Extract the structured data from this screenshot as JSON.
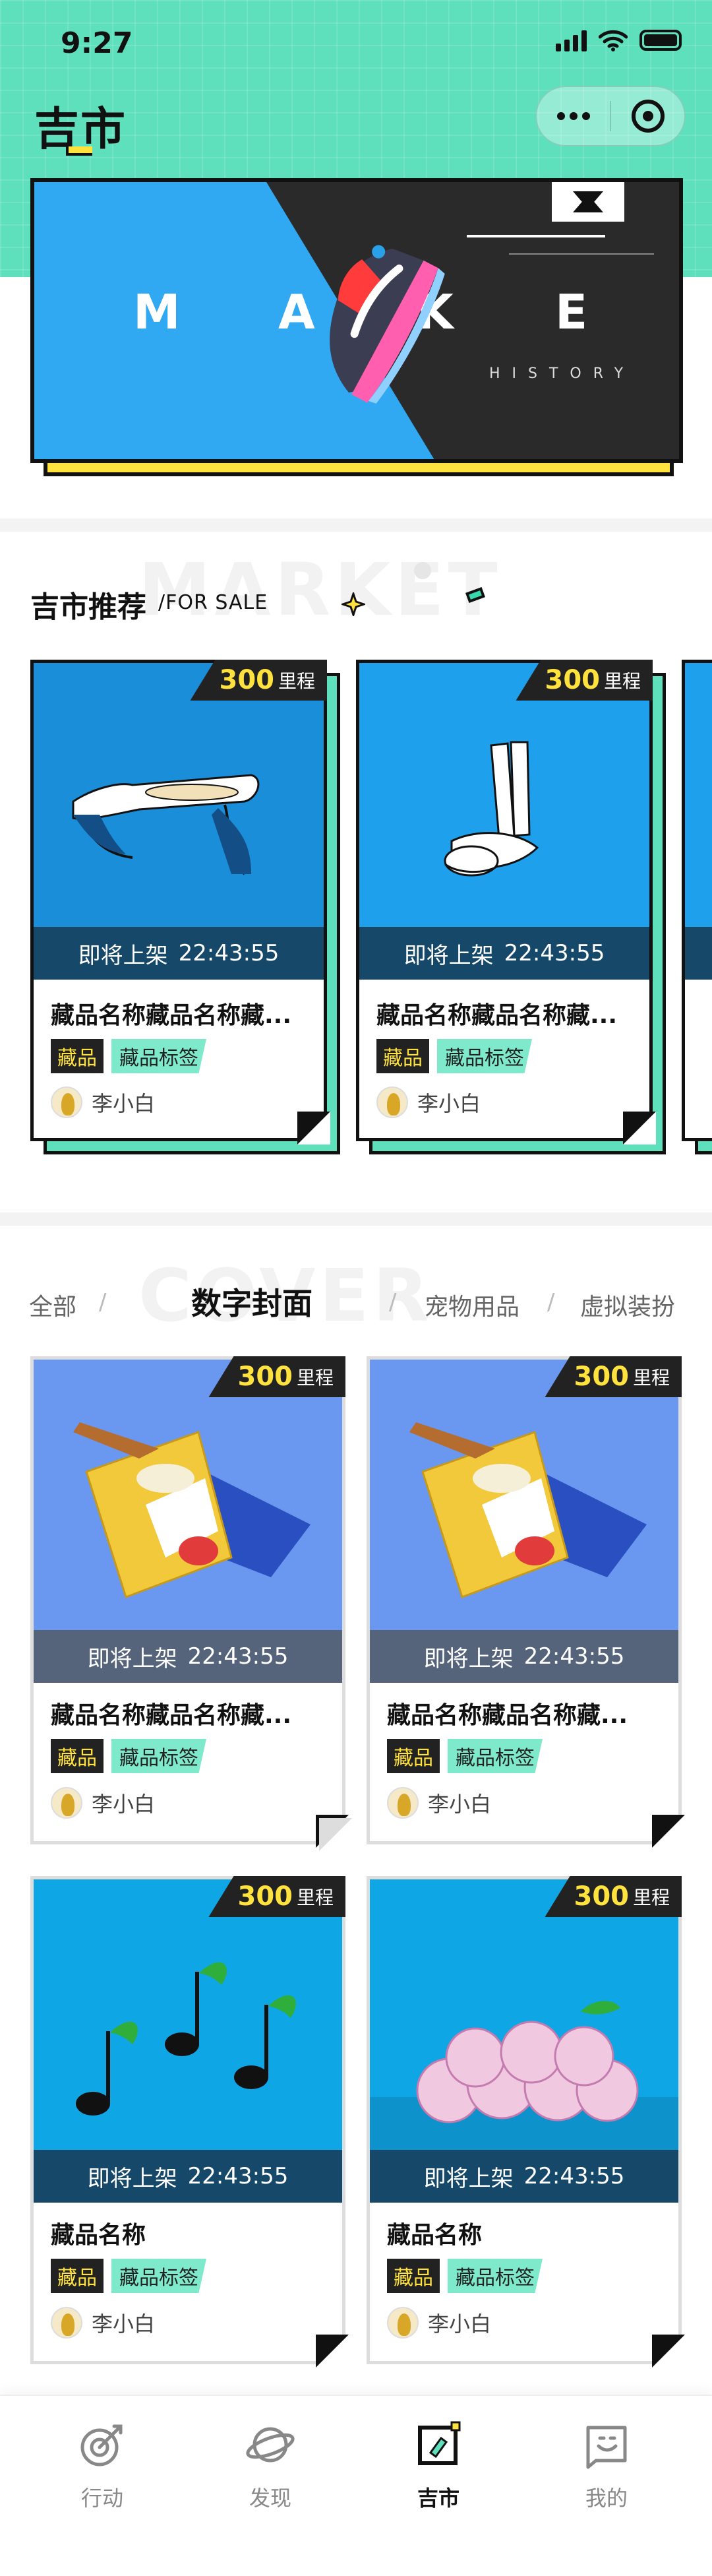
{
  "status_bar": {
    "time": "9:27"
  },
  "header": {
    "logo": "吉市"
  },
  "banner": {
    "letters": [
      "M",
      "A",
      "K",
      "E"
    ],
    "subtitle": "HISTORY"
  },
  "recommend": {
    "title": "吉市推荐",
    "subtitle": "/FOR SALE",
    "ghost_text": "MARKET",
    "cards": [
      {
        "price": "300",
        "unit": "里程",
        "status": "即将上架",
        "countdown": "22:43:55",
        "title": "藏品名称藏品名称藏...",
        "tag1": "藏品",
        "tag2": "藏品标签",
        "author": "李小白"
      },
      {
        "price": "300",
        "unit": "里程",
        "status": "即将上架",
        "countdown": "22:43:55",
        "title": "藏品名称藏品名称藏...",
        "tag1": "藏品",
        "tag2": "藏品标签",
        "author": "李小白"
      }
    ]
  },
  "tabs": {
    "ghost_text": "COVER",
    "items": [
      "全部",
      "数字封面",
      "宠物用品",
      "虚拟装扮"
    ],
    "active": "数字封面"
  },
  "grid": {
    "cards": [
      {
        "price": "300",
        "unit": "里程",
        "status": "即将上架",
        "countdown": "22:43:55",
        "title": "藏品名称藏品名称藏...",
        "tag1": "藏品",
        "tag2": "藏品标签",
        "author": "李小白"
      },
      {
        "price": "300",
        "unit": "里程",
        "status": "即将上架",
        "countdown": "22:43:55",
        "title": "藏品名称藏品名称藏...",
        "tag1": "藏品",
        "tag2": "藏品标签",
        "author": "李小白"
      },
      {
        "price": "300",
        "unit": "里程",
        "status": "即将上架",
        "countdown": "22:43:55",
        "title": "藏品名称",
        "tag1": "藏品",
        "tag2": "藏品标签",
        "author": "李小白"
      },
      {
        "price": "300",
        "unit": "里程",
        "status": "即将上架",
        "countdown": "22:43:55",
        "title": "藏品名称",
        "tag1": "藏品",
        "tag2": "藏品标签",
        "author": "李小白"
      }
    ]
  },
  "nav": {
    "items": [
      {
        "label": "行动",
        "icon": "target-icon"
      },
      {
        "label": "发现",
        "icon": "planet-icon"
      },
      {
        "label": "吉市",
        "icon": "market-icon"
      },
      {
        "label": "我的",
        "icon": "profile-icon"
      }
    ],
    "active_index": 2
  },
  "colors": {
    "mint": "#5ee0bd",
    "yellow": "#ffe23d",
    "dark": "#111111",
    "sky": "#30a8f2"
  }
}
